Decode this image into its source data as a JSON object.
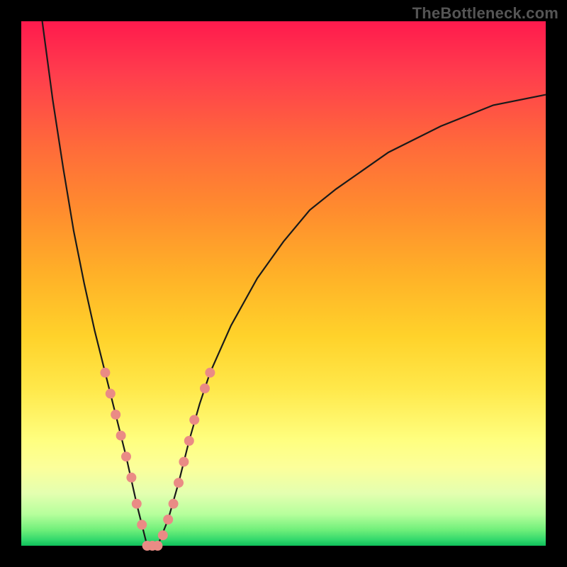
{
  "watermark": "TheBottleneck.com",
  "chart_data": {
    "type": "line",
    "title": "",
    "xlabel": "",
    "ylabel": "",
    "xlim": [
      0,
      100
    ],
    "ylim": [
      0,
      100
    ],
    "grid": false,
    "legend": false,
    "description": "V-shaped bottleneck curve over a red-to-green vertical gradient. Y represents bottleneck percentage (0 at bottom/green = ideal, 100 at top/red = severe). X is a normalized component-strength axis. Minimum near x≈24.",
    "series": [
      {
        "name": "bottleneck-curve",
        "x": [
          4,
          6,
          8,
          10,
          12,
          14,
          16,
          18,
          20,
          22,
          24,
          26,
          28,
          30,
          32,
          34,
          36,
          40,
          45,
          50,
          55,
          60,
          70,
          80,
          90,
          100
        ],
        "y": [
          100,
          85,
          72,
          60,
          50,
          41,
          33,
          25,
          17,
          8,
          0,
          0,
          5,
          12,
          20,
          27,
          33,
          42,
          51,
          58,
          64,
          68,
          75,
          80,
          84,
          86
        ]
      }
    ],
    "markers": {
      "name": "highlighted-points",
      "color": "#ea8b85",
      "points": [
        {
          "x": 16,
          "y": 33
        },
        {
          "x": 17,
          "y": 29
        },
        {
          "x": 18,
          "y": 25
        },
        {
          "x": 19,
          "y": 21
        },
        {
          "x": 20,
          "y": 17
        },
        {
          "x": 21,
          "y": 13
        },
        {
          "x": 22,
          "y": 8
        },
        {
          "x": 23,
          "y": 4
        },
        {
          "x": 24,
          "y": 0
        },
        {
          "x": 25,
          "y": 0
        },
        {
          "x": 26,
          "y": 0
        },
        {
          "x": 27,
          "y": 2
        },
        {
          "x": 28,
          "y": 5
        },
        {
          "x": 29,
          "y": 8
        },
        {
          "x": 30,
          "y": 12
        },
        {
          "x": 31,
          "y": 16
        },
        {
          "x": 32,
          "y": 20
        },
        {
          "x": 33,
          "y": 24
        },
        {
          "x": 35,
          "y": 30
        },
        {
          "x": 36,
          "y": 33
        }
      ]
    },
    "gradient_stops": [
      {
        "pct": 0,
        "color": "#ff1a4d"
      },
      {
        "pct": 50,
        "color": "#ffd22a"
      },
      {
        "pct": 85,
        "color": "#fcff9a"
      },
      {
        "pct": 100,
        "color": "#0fbf5a"
      }
    ]
  }
}
